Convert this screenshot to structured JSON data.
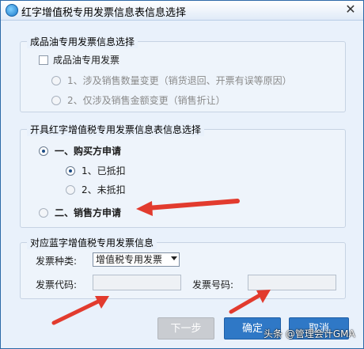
{
  "window": {
    "title": "红字增值税专用发票信息表信息选择",
    "close_glyph": "✕"
  },
  "group_oil": {
    "legend": "成品油专用发票信息选择",
    "checkbox_label": "成品油专用发票",
    "option1": "1、涉及销售数量变更（销货退回、开票有误等原因）",
    "option2": "2、仅涉及销售金额变更（销售折让）"
  },
  "group_red": {
    "legend": "开具红字增值税专用发票信息表信息选择",
    "buyer_apply": "一、购买方申请",
    "sub1": "1、已抵扣",
    "sub2": "2、未抵扣",
    "seller_apply": "二、销售方申请"
  },
  "group_blue": {
    "legend": "对应蓝字增值税专用发票信息",
    "type_label": "发票种类:",
    "type_value": "增值税专用发票",
    "code_label": "发票代码:",
    "code_value": "",
    "number_label": "发票号码:",
    "number_value": ""
  },
  "buttons": {
    "prev": "下一步",
    "ok": "确定",
    "cancel": "取消"
  },
  "watermark": "头条 @管理会计GMA",
  "colors": {
    "arrow": "#e23b2e",
    "button_primary": "#2f78c6",
    "button_disabled": "#c9ccd1"
  }
}
